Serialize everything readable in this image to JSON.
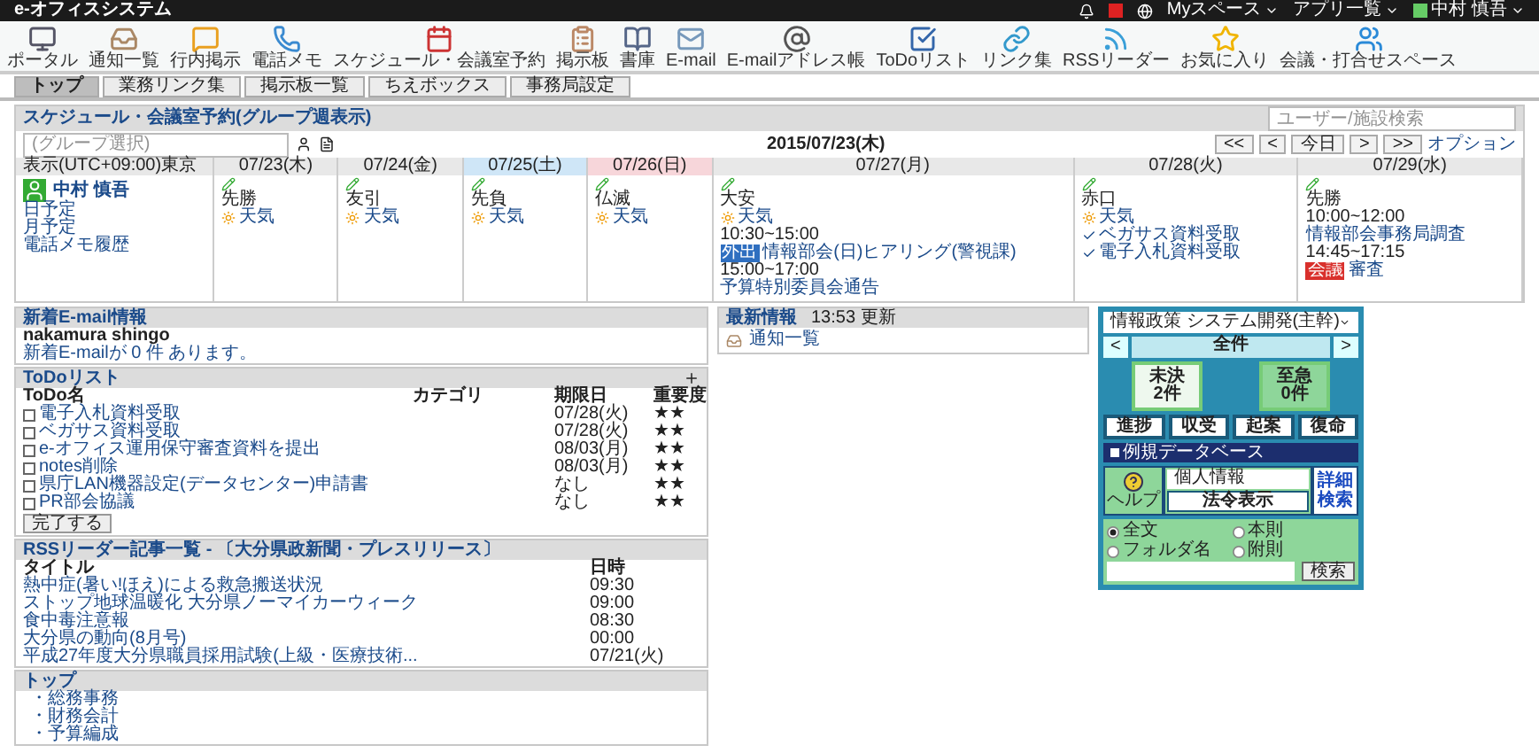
{
  "app_bar": {
    "title": "e-オフィスシステム",
    "menus": [
      {
        "label": "Myスペース"
      },
      {
        "label": "アプリ一覧"
      },
      {
        "label": "中村 慎吾"
      }
    ]
  },
  "toolbar": [
    {
      "label": "ポータル"
    },
    {
      "label": "通知一覧"
    },
    {
      "label": "行内掲示"
    },
    {
      "label": "電話メモ"
    },
    {
      "label": "スケジュール・会議室予約"
    },
    {
      "label": "掲示板"
    },
    {
      "label": "書庫"
    },
    {
      "label": "E-mail"
    },
    {
      "label": "E-mailアドレス帳"
    },
    {
      "label": "ToDoリスト"
    },
    {
      "label": "リンク集"
    },
    {
      "label": "RSSリーダー"
    },
    {
      "label": "お気に入り"
    },
    {
      "label": "会議・打合せスペース"
    }
  ],
  "tabs": [
    {
      "label": "トップ",
      "selected": true
    },
    {
      "label": "業務リンク集",
      "selected": false
    },
    {
      "label": "掲示板一覧",
      "selected": false
    },
    {
      "label": "ちえボックス",
      "selected": false
    },
    {
      "label": "事務局設定",
      "selected": false
    }
  ],
  "schedule": {
    "title": "スケジュール・会議室予約(グループ週表示)",
    "search": {
      "placeholder": "ユーザー/施設検索"
    },
    "group": {
      "placeholder": "(グループ選択)"
    },
    "date": "2015/07/23(木)",
    "nav": [
      "<<",
      "<",
      "今日",
      ">",
      ">>"
    ],
    "option": "オプション",
    "timezone": "表示(UTC+09:00)東京",
    "user": {
      "name": "中村 慎吾",
      "links": [
        {
          "label": "日予定"
        },
        {
          "label": "月予定"
        },
        {
          "label": "電話メモ履歴"
        }
      ]
    },
    "days": [
      {
        "date": "07/23(木)",
        "kind": "weekday",
        "rokuyo": "先勝",
        "weather": "天気"
      },
      {
        "date": "07/24(金)",
        "kind": "weekday",
        "rokuyo": "友引",
        "weather": "天気"
      },
      {
        "date": "07/25(土)",
        "kind": "saturday",
        "rokuyo": "先負",
        "weather": "天気"
      },
      {
        "date": "07/26(日)",
        "kind": "sunday",
        "rokuyo": "仏滅",
        "weather": "天気"
      },
      {
        "date": "07/27(月)",
        "kind": "weekday",
        "rokuyo": "大安",
        "weather": "天気",
        "entries": [
          {
            "kind": "event",
            "time": "10:30~15:00",
            "tag": "外出",
            "color": "#2f6fc0",
            "title": "情報部会(日)ヒアリング(警視課)"
          },
          {
            "kind": "event",
            "time": "15:00~17:00",
            "title": "予算特別委員会通告"
          }
        ]
      },
      {
        "date": "07/28(火)",
        "kind": "weekday",
        "rokuyo": "赤口",
        "weather": "天気",
        "entries": [
          {
            "kind": "todo",
            "title": "ベガサス資料受取"
          },
          {
            "kind": "todo",
            "title": "電子入札資料受取"
          }
        ]
      },
      {
        "date": "07/29(水)",
        "kind": "weekday",
        "rokuyo": "先勝",
        "entries": [
          {
            "kind": "event",
            "time": "10:00~12:00",
            "title": "情報部会事務局調査"
          },
          {
            "kind": "event",
            "time": "14:45~17:15",
            "tag": "会議",
            "color": "#d9302c",
            "title": "審査"
          }
        ]
      }
    ]
  },
  "email": {
    "title": "新着E-mail情報",
    "account": "nakamura shingo",
    "message": "新着E-mailが 0 件 あります。"
  },
  "todo": {
    "title": "ToDoリスト",
    "columns": [
      "ToDo名",
      "カテゴリ",
      "期限日",
      "重要度"
    ],
    "rows": [
      {
        "name": "電子入札資料受取",
        "due": "07/28(火)",
        "priority": "★★",
        "checked": false
      },
      {
        "name": "ベガサス資料受取",
        "due": "07/28(火)",
        "priority": "★★",
        "checked": false
      },
      {
        "name": "e-オフィス運用保守審査資料を提出",
        "due": "08/03(月)",
        "priority": "★★",
        "checked": false
      },
      {
        "name": "notes削除",
        "due": "08/03(月)",
        "priority": "★★",
        "checked": false
      },
      {
        "name": "県庁LAN機器設定(データセンター)申請書",
        "due": "なし",
        "priority": "★★",
        "checked": false
      },
      {
        "name": "PR部会協議",
        "due": "なし",
        "priority": "★★",
        "checked": false
      }
    ],
    "button": "完了する"
  },
  "rss": {
    "title": "RSSリーダー記事一覧 - 〔大分県政新聞・プレスリリース〕",
    "columns": [
      "タイトル",
      "日時"
    ],
    "rows": [
      {
        "title": "熱中症(暑い!ほえ)による救急搬送状況",
        "time": "09:30"
      },
      {
        "title": "ストップ地球温暖化 大分県ノーマイカーウィーク",
        "time": "09:00"
      },
      {
        "title": "食中毒注意報",
        "time": "08:30"
      },
      {
        "title": "大分県の動向(8月号)",
        "time": "00:00"
      },
      {
        "title": "平成27年度大分県職員採用試験(上級・医療技術...",
        "time": "07/21(火)"
      }
    ]
  },
  "top_links": {
    "title": "トップ",
    "items": [
      "・総務事務",
      "・財務会計",
      "・予算編成"
    ]
  },
  "news": {
    "title": "最新情報",
    "updated": "13:53 更新",
    "link": "通知一覧"
  },
  "widget": {
    "dept": "情報政策 システム開発(主幹)",
    "prev": "<",
    "filter": "全件",
    "next": ">",
    "trays": [
      {
        "label": "未決",
        "count": "2件"
      },
      {
        "label": "至急",
        "count": "0件"
      }
    ],
    "actions": [
      "進捗",
      "収受",
      "起案",
      "復命"
    ],
    "db_title": "例規データベース",
    "help": "ヘルプ",
    "category": "個人情報",
    "show": "法令表示",
    "detail": "詳細検索",
    "radios": [
      {
        "label": "全文",
        "selected": true
      },
      {
        "label": "本則",
        "selected": false
      },
      {
        "label": "フォルダ名",
        "selected": false
      },
      {
        "label": "附則",
        "selected": false
      }
    ],
    "search_button": "検索"
  }
}
